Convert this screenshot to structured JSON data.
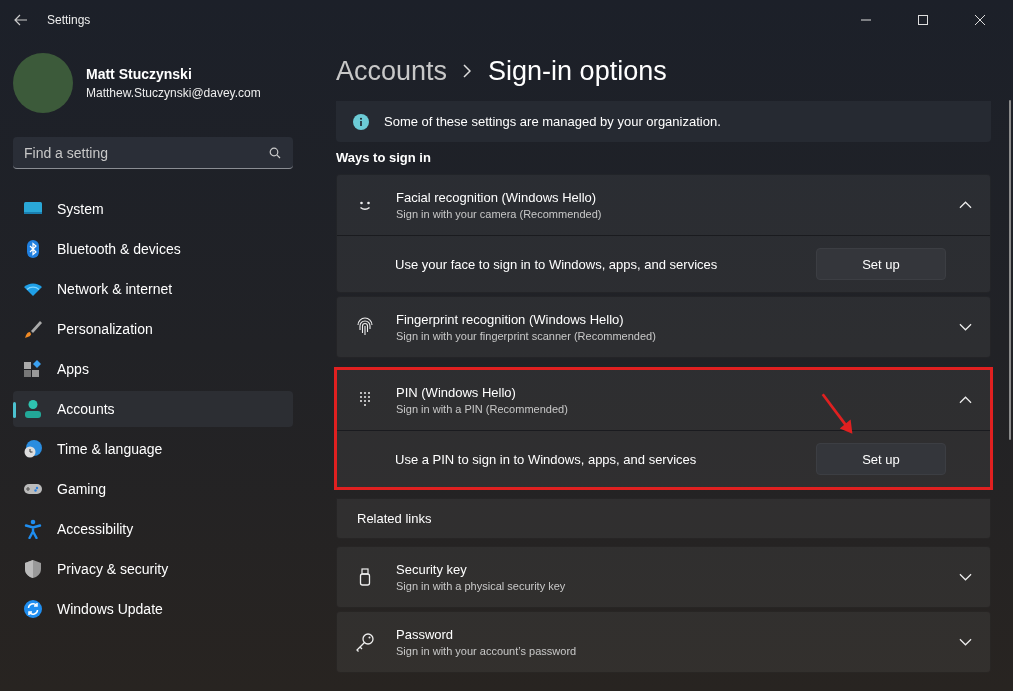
{
  "window": {
    "title": "Settings"
  },
  "profile": {
    "name": "Matt Stuczynski",
    "email": "Matthew.Stuczynski@davey.com"
  },
  "search": {
    "placeholder": "Find a setting"
  },
  "nav": [
    {
      "label": "System",
      "selected": false
    },
    {
      "label": "Bluetooth & devices",
      "selected": false
    },
    {
      "label": "Network & internet",
      "selected": false
    },
    {
      "label": "Personalization",
      "selected": false
    },
    {
      "label": "Apps",
      "selected": false
    },
    {
      "label": "Accounts",
      "selected": true
    },
    {
      "label": "Time & language",
      "selected": false
    },
    {
      "label": "Gaming",
      "selected": false
    },
    {
      "label": "Accessibility",
      "selected": false
    },
    {
      "label": "Privacy & security",
      "selected": false
    },
    {
      "label": "Windows Update",
      "selected": false
    }
  ],
  "breadcrumb": [
    "Accounts",
    "Sign-in options"
  ],
  "info_banner": "Some of these settings are managed by your organization.",
  "section_title": "Ways to sign in",
  "items": [
    {
      "kind": "expander",
      "title": "Facial recognition (Windows Hello)",
      "subtitle": "Sign in with your camera (Recommended)",
      "expanded": true,
      "highlighted": false,
      "detail": {
        "text": "Use your face to sign in to Windows, apps, and services",
        "button": "Set up"
      }
    },
    {
      "kind": "expander",
      "title": "Fingerprint recognition (Windows Hello)",
      "subtitle": "Sign in with your fingerprint scanner (Recommended)",
      "expanded": false,
      "highlighted": false
    },
    {
      "kind": "expander",
      "title": "PIN (Windows Hello)",
      "subtitle": "Sign in with a PIN (Recommended)",
      "expanded": true,
      "highlighted": true,
      "detail": {
        "text": "Use a PIN to sign in to Windows, apps, and services",
        "button": "Set up"
      }
    },
    {
      "kind": "header",
      "title": "Related links"
    },
    {
      "kind": "expander",
      "title": "Security key",
      "subtitle": "Sign in with a physical security key",
      "expanded": false,
      "highlighted": false
    },
    {
      "kind": "expander",
      "title": "Password",
      "subtitle": "Sign in with your account’s password",
      "expanded": false,
      "highlighted": false
    }
  ]
}
